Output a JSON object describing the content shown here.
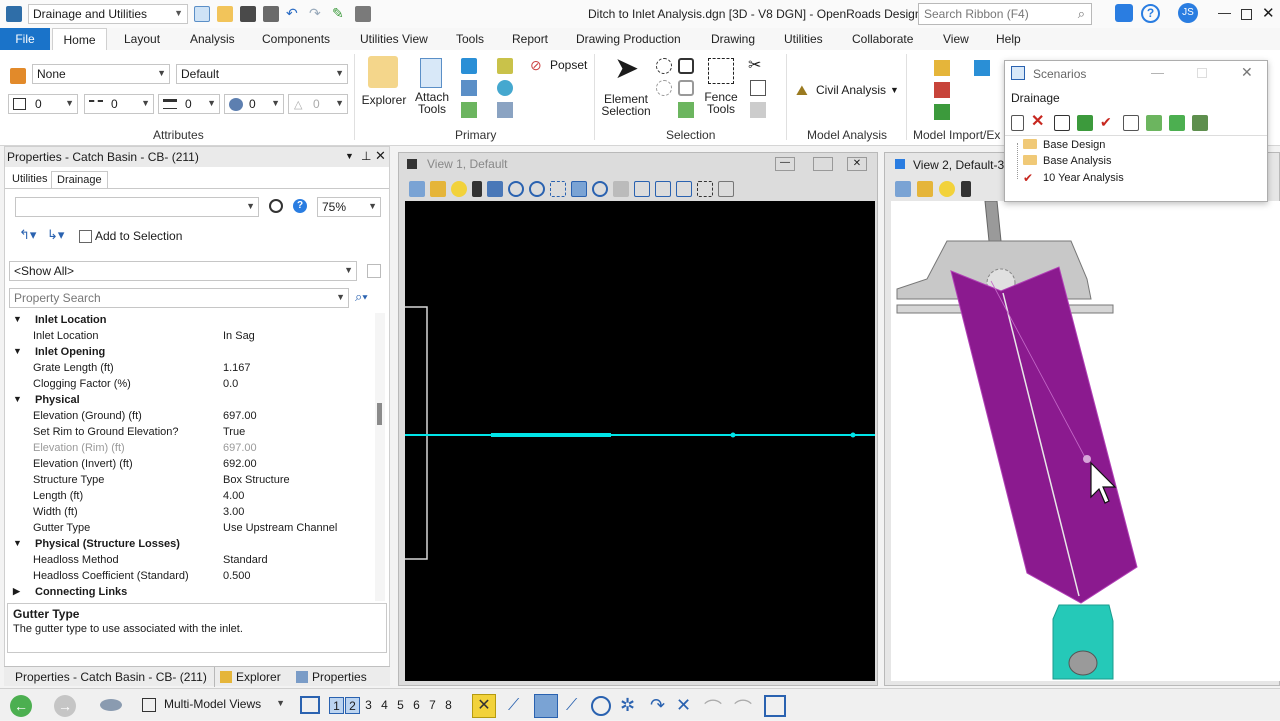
{
  "app": {
    "window_title": "Ditch to Inlet Analysis.dgn [3D - V8 DGN] - OpenRoads Design",
    "workflow": "Drainage and Utilities",
    "search_placeholder": "Search Ribbon (F4)",
    "user_initials": "JS"
  },
  "menu": {
    "tabs": [
      "File",
      "Home",
      "Layout",
      "Analysis",
      "Components",
      "Utilities View",
      "Tools",
      "Report",
      "Drawing Production",
      "Drawing",
      "Utilities",
      "Collaborate",
      "View",
      "Help"
    ]
  },
  "ribbon": {
    "attributes": {
      "level": "None",
      "style": "Default",
      "color": "0",
      "weight": "0",
      "linestyle": "0",
      "transparency": "0",
      "priority": "0",
      "label": "Attributes"
    },
    "primary": {
      "explorer": "Explorer",
      "attach_tools_1": "Attach",
      "attach_tools_2": "Tools",
      "popset": "Popset",
      "label": "Primary"
    },
    "selection": {
      "element_selection_1": "Element",
      "element_selection_2": "Selection",
      "fence_tools_1": "Fence",
      "fence_tools_2": "Tools",
      "label": "Selection"
    },
    "model_analysis": {
      "civil_analysis": "Civil Analysis",
      "label": "Model Analysis"
    },
    "model_import": {
      "label": "Model Import/Ex"
    }
  },
  "properties": {
    "title": "Properties - Catch Basin - CB- (211)",
    "tabs": [
      "Utilities",
      "Drainage"
    ],
    "zoom": "75%",
    "add_to_selection": "Add to Selection",
    "show_all": "<Show All>",
    "search_placeholder": "Property Search",
    "rows": [
      {
        "type": "cat",
        "name": "Inlet Location"
      },
      {
        "type": "prop",
        "name": "Inlet Location",
        "value": "In Sag"
      },
      {
        "type": "cat",
        "name": "Inlet Opening"
      },
      {
        "type": "prop",
        "name": "Grate Length (ft)",
        "value": "1.167"
      },
      {
        "type": "prop",
        "name": "Clogging Factor (%)",
        "value": "0.0"
      },
      {
        "type": "cat",
        "name": "Physical"
      },
      {
        "type": "prop",
        "name": "Elevation (Ground) (ft)",
        "value": "697.00"
      },
      {
        "type": "prop",
        "name": "Set Rim to Ground Elevation?",
        "value": "True"
      },
      {
        "type": "dim",
        "name": "Elevation (Rim) (ft)",
        "value": "697.00"
      },
      {
        "type": "prop",
        "name": "Elevation (Invert) (ft)",
        "value": "692.00"
      },
      {
        "type": "prop",
        "name": "Structure Type",
        "value": "Box Structure"
      },
      {
        "type": "prop",
        "name": "Length (ft)",
        "value": "4.00"
      },
      {
        "type": "prop",
        "name": "Width (ft)",
        "value": "3.00"
      },
      {
        "type": "prop",
        "name": "Gutter Type",
        "value": "Use Upstream Channel"
      },
      {
        "type": "cat",
        "name": "Physical (Structure Losses)"
      },
      {
        "type": "prop",
        "name": "Headloss Method",
        "value": "Standard"
      },
      {
        "type": "prop",
        "name": "Headloss Coefficient (Standard)",
        "value": "0.500"
      },
      {
        "type": "catc",
        "name": "Connecting Links"
      }
    ],
    "description_title": "Gutter Type",
    "description_text": "The gutter type to use associated with the inlet.",
    "bottom_tabs": [
      "Properties - Catch Basin - CB- (211)",
      "Explorer",
      "Properties"
    ]
  },
  "views": {
    "view1_title": "View 1, Default",
    "view2_title": "View 2, Default-3"
  },
  "scenarios": {
    "title": "Scenarios",
    "tab": "Drainage",
    "items": [
      "Base Design",
      "Base Analysis",
      "10 Year Analysis"
    ]
  },
  "statusbar": {
    "view_mode": "Multi-Model Views",
    "view_numbers": [
      "1",
      "2",
      "3",
      "4",
      "5",
      "6",
      "7",
      "8"
    ]
  },
  "colors": {
    "accent": "#1a73c9",
    "pipe": "#00e5e8",
    "ditch": "#8b1a8f",
    "inlet": "#25c9b8"
  }
}
